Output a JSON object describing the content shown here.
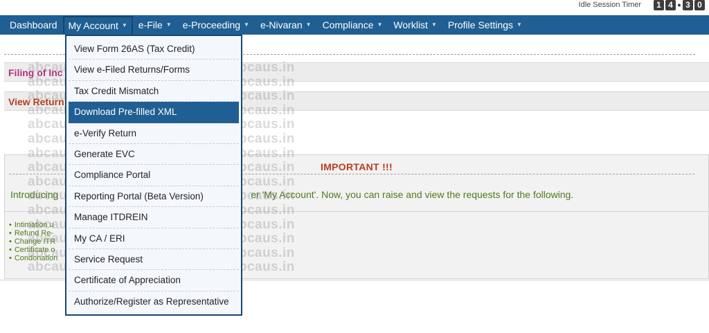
{
  "timer": {
    "label": "Idle Session Timer",
    "digits": [
      "1",
      "4",
      "3",
      "0"
    ]
  },
  "nav": {
    "items": [
      {
        "label": "Dashboard",
        "caret": false,
        "active": false
      },
      {
        "label": "My Account",
        "caret": true,
        "active": true
      },
      {
        "label": "e-File",
        "caret": true,
        "active": false
      },
      {
        "label": "e-Proceeding",
        "caret": true,
        "active": false
      },
      {
        "label": "e-Nivaran",
        "caret": true,
        "active": false
      },
      {
        "label": "Compliance",
        "caret": true,
        "active": false
      },
      {
        "label": "Worklist",
        "caret": true,
        "active": false
      },
      {
        "label": "Profile Settings",
        "caret": true,
        "active": false
      }
    ],
    "caret_icon": "caret-down-icon"
  },
  "dropdown": {
    "items": [
      "View Form 26AS (Tax Credit)",
      "View e-Filed Returns/Forms",
      "Tax Credit Mismatch",
      "Download Pre-filled XML",
      "e-Verify Return",
      "Generate EVC",
      "Compliance Portal",
      "Reporting Portal (Beta Version)",
      "Manage ITDREIN",
      "My CA / ERI",
      "Service Request",
      "Certificate of Appreciation",
      "Authorize/Register as Representative"
    ],
    "highlighted_index": 3
  },
  "bars": {
    "filing": "Filing of Inc",
    "view_return": "View Return"
  },
  "important": {
    "title": "IMPORTANT !!!",
    "intro_left": "Introducing",
    "intro_right": "er 'My Account'. Now, you can raise and view the requests for the following.",
    "list": [
      "Intimation u",
      "Refund Re-",
      "Change ITR",
      "Certificate o",
      "Condonation"
    ]
  },
  "watermark": {
    "rows": [
      "abcaus.in abcaus.in abcaus.in abcaus.in",
      "abcaus.in abcaus.in abcaus.in abcaus.in",
      "abcaus.in abcaus.in abcaus.in abcaus.in",
      "abcaus.in abcaus.in abcaus.in abcaus.in",
      "abcaus.in abcaus.in abcaus.in abcaus.in",
      "abcaus.in abcaus.in abcaus.in abcaus.in",
      "abcaus.in abcaus.in abcaus.in abcaus.in",
      "abcaus.in abcaus.in abcaus.in abcaus.in",
      "abcaus.in abcaus.in abcaus.in abcaus.in",
      "abcaus.in abcaus.in abcaus.in abcaus.in",
      "abcaus.in abcaus.in abcaus.in abcaus.in",
      "abcaus.in abcaus.in abcaus.in abcaus.in",
      "abcaus.in abcaus.in abcaus.in abcaus.in",
      "abcaus.in abcaus.in abcaus.in abcaus.in",
      "abcaus.in abcaus.in abcaus.in abcaus.in"
    ]
  },
  "colors": {
    "nav_bg": "#1f5f93",
    "nav_border": "#134670",
    "filing_text": "#b4327e",
    "view_return_text": "#b53f1c",
    "important_text": "#b83c1b",
    "intro_text": "#4d7b1a"
  }
}
